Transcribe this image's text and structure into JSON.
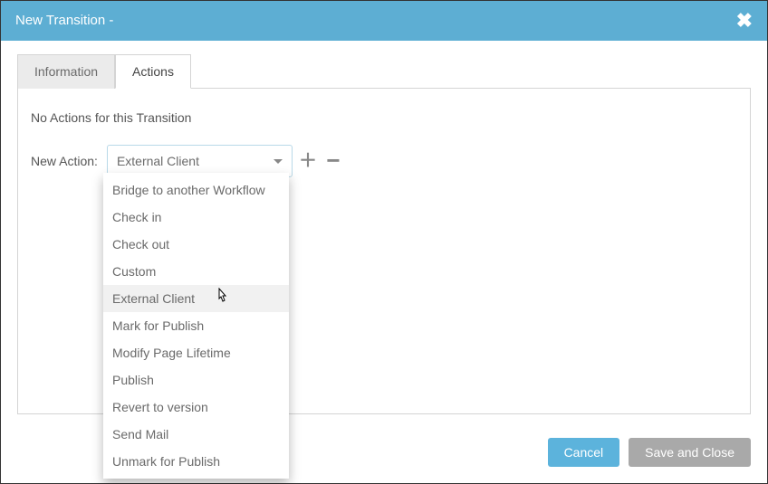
{
  "dialog": {
    "title": "New Transition -"
  },
  "tabs": {
    "information": "Information",
    "actions": "Actions"
  },
  "panel": {
    "empty_msg": "No Actions for this Transition",
    "new_action_label": "New Action:",
    "selected": "External Client",
    "options": {
      "o0": "Bridge to another Workflow",
      "o1": "Check in",
      "o2": "Check out",
      "o3": "Custom",
      "o4": "External Client",
      "o5": "Mark for Publish",
      "o6": "Modify Page Lifetime",
      "o7": "Publish",
      "o8": "Revert to version",
      "o9": "Send Mail",
      "o10": "Unmark for Publish"
    }
  },
  "footer": {
    "cancel": "Cancel",
    "save": "Save and Close"
  }
}
